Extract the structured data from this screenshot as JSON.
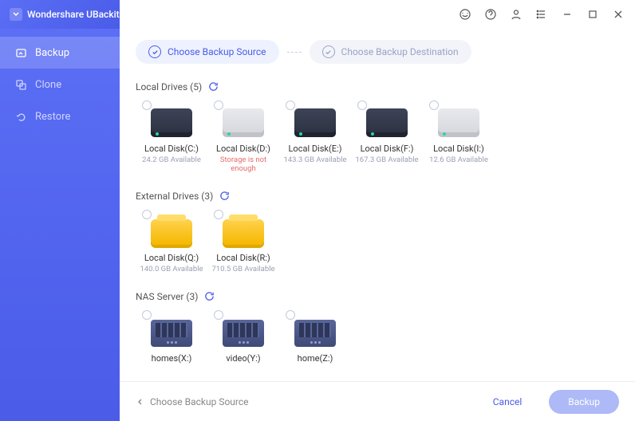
{
  "app": {
    "title": "Wondershare UBackit"
  },
  "sidebar": {
    "items": [
      {
        "label": "Backup"
      },
      {
        "label": "Clone"
      },
      {
        "label": "Restore"
      }
    ]
  },
  "steps": {
    "source": "Choose Backup Source",
    "destination": "Choose Backup Destination"
  },
  "sections": {
    "local": {
      "title": "Local Drives (5)"
    },
    "external": {
      "title": "External Drives (3)"
    },
    "nas": {
      "title": "NAS Server (3)"
    }
  },
  "drives": {
    "local": [
      {
        "name": "Local Disk(C:)",
        "sub": "24.2 GB Available",
        "style": "dark"
      },
      {
        "name": "Local Disk(D:)",
        "sub": "Storage is not enough",
        "style": "light",
        "error": true
      },
      {
        "name": "Local Disk(E:)",
        "sub": "143.3 GB Available",
        "style": "dark"
      },
      {
        "name": "Local Disk(F:)",
        "sub": "167.3 GB Available",
        "style": "dark"
      },
      {
        "name": "Local Disk(I:)",
        "sub": "12.6 GB Available",
        "style": "light"
      }
    ],
    "external": [
      {
        "name": "Local Disk(Q:)",
        "sub": "140.0 GB Available"
      },
      {
        "name": "Local Disk(R:)",
        "sub": "710.5 GB Available"
      }
    ],
    "nas": [
      {
        "name": "homes(X:)"
      },
      {
        "name": "video(Y:)"
      },
      {
        "name": "home(Z:)"
      }
    ]
  },
  "footer": {
    "hint": "Choose Backup Source",
    "cancel": "Cancel",
    "primary": "Backup"
  }
}
